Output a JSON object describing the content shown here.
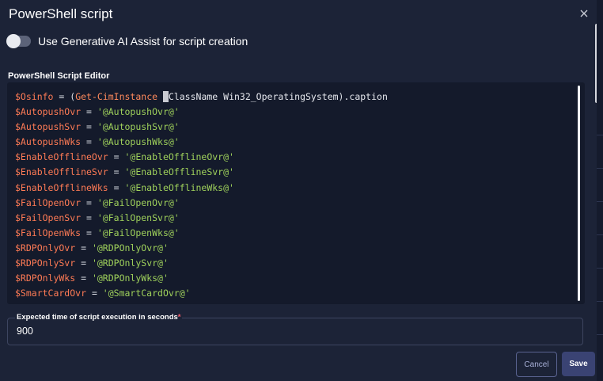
{
  "dialog": {
    "title": "PowerShell script",
    "close_icon": "close-icon"
  },
  "ai_toggle": {
    "label": "Use Generative AI Assist for script creation",
    "enabled": false
  },
  "editor": {
    "label": "PowerShell Script Editor",
    "lines": [
      [
        [
          "var",
          "$Osinfo"
        ],
        [
          "op",
          " = "
        ],
        [
          "op",
          "("
        ],
        [
          "cmd",
          "Get-CimInstance "
        ],
        [
          "sel",
          " "
        ],
        [
          "plain",
          "ClassName Win32_OperatingSystem"
        ],
        [
          "op",
          ")"
        ],
        [
          "plain",
          ".caption"
        ]
      ],
      [
        [
          "var",
          "$AutopushOvr"
        ],
        [
          "op",
          " = "
        ],
        [
          "str",
          "'@AutopushOvr@'"
        ]
      ],
      [
        [
          "var",
          "$AutopushSvr"
        ],
        [
          "op",
          " = "
        ],
        [
          "str",
          "'@AutopushSvr@'"
        ]
      ],
      [
        [
          "var",
          "$AutopushWks"
        ],
        [
          "op",
          " = "
        ],
        [
          "str",
          "'@AutopushWks@'"
        ]
      ],
      [
        [
          "var",
          "$EnableOfflineOvr"
        ],
        [
          "op",
          " = "
        ],
        [
          "str",
          "'@EnableOfflineOvr@'"
        ]
      ],
      [
        [
          "var",
          "$EnableOfflineSvr"
        ],
        [
          "op",
          " = "
        ],
        [
          "str",
          "'@EnableOfflineSvr@'"
        ]
      ],
      [
        [
          "var",
          "$EnableOfflineWks"
        ],
        [
          "op",
          " = "
        ],
        [
          "str",
          "'@EnableOfflineWks@'"
        ]
      ],
      [
        [
          "var",
          "$FailOpenOvr"
        ],
        [
          "op",
          " = "
        ],
        [
          "str",
          "'@FailOpenOvr@'"
        ]
      ],
      [
        [
          "var",
          "$FailOpenSvr"
        ],
        [
          "op",
          " = "
        ],
        [
          "str",
          "'@FailOpenSvr@'"
        ]
      ],
      [
        [
          "var",
          "$FailOpenWks"
        ],
        [
          "op",
          " = "
        ],
        [
          "str",
          "'@FailOpenWks@'"
        ]
      ],
      [
        [
          "var",
          "$RDPOnlyOvr"
        ],
        [
          "op",
          " = "
        ],
        [
          "str",
          "'@RDPOnlyOvr@'"
        ]
      ],
      [
        [
          "var",
          "$RDPOnlySvr"
        ],
        [
          "op",
          " = "
        ],
        [
          "str",
          "'@RDPOnlySvr@'"
        ]
      ],
      [
        [
          "var",
          "$RDPOnlyWks"
        ],
        [
          "op",
          " = "
        ],
        [
          "str",
          "'@RDPOnlyWks@'"
        ]
      ],
      [
        [
          "var",
          "$SmartCardOvr"
        ],
        [
          "op",
          " = "
        ],
        [
          "str",
          "'@SmartCardOvr@'"
        ]
      ]
    ]
  },
  "execution_time": {
    "label": "Expected time of script execution in seconds",
    "required_mark": "*",
    "value": "900"
  },
  "buttons": {
    "cancel": "Cancel",
    "save": "Save"
  },
  "colors": {
    "background": "#1c2337",
    "editor_background": "#141a2b",
    "variable": "#ff7b55",
    "string": "#9fd15b",
    "save_button": "#3a4373"
  }
}
